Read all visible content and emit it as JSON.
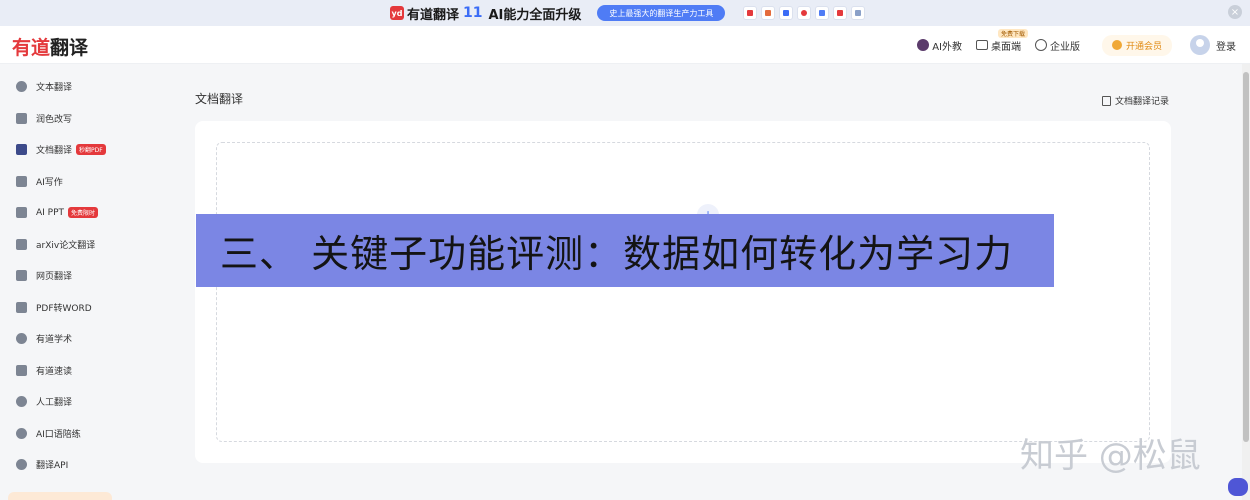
{
  "promo": {
    "logo": "yd",
    "title": "有道翻译",
    "version": "11",
    "subtitle": "AI能力全面升级",
    "pill": "史上最强大的翻译生产力工具",
    "close": "×"
  },
  "header": {
    "logo_red": "有道",
    "logo_dark": "翻译",
    "nav": {
      "ai_tutor": "AI外教",
      "desktop": "桌面端",
      "desktop_tag": "免费下载",
      "enterprise": "企业版",
      "vip": "开通会员",
      "login": "登录"
    }
  },
  "sidebar": {
    "items": [
      {
        "label": "文本翻译"
      },
      {
        "label": "润色改写"
      },
      {
        "label": "文档翻译",
        "badge": "秒翻PDF"
      },
      {
        "label": "AI写作"
      },
      {
        "label": "AI PPT",
        "badge": "免费限时"
      },
      {
        "label": "arXiv论文翻译"
      },
      {
        "label": "网页翻译"
      },
      {
        "label": "PDF转WORD"
      },
      {
        "label": "有道学术"
      },
      {
        "label": "有道速读"
      },
      {
        "label": "人工翻译"
      },
      {
        "label": "AI口语陪练"
      },
      {
        "label": "翻译API"
      }
    ]
  },
  "main": {
    "title": "文档翻译",
    "history": "文档翻译记录",
    "upload_icon": "+"
  },
  "overlay": {
    "caption": "三、 关键子功能评测：数据如何转化为学习力"
  },
  "watermark": "知乎 @松鼠",
  "colors": {
    "brand_red": "#e4393c",
    "accent_blue": "#4f7cf5",
    "caption_bg": "#7b86e4"
  }
}
